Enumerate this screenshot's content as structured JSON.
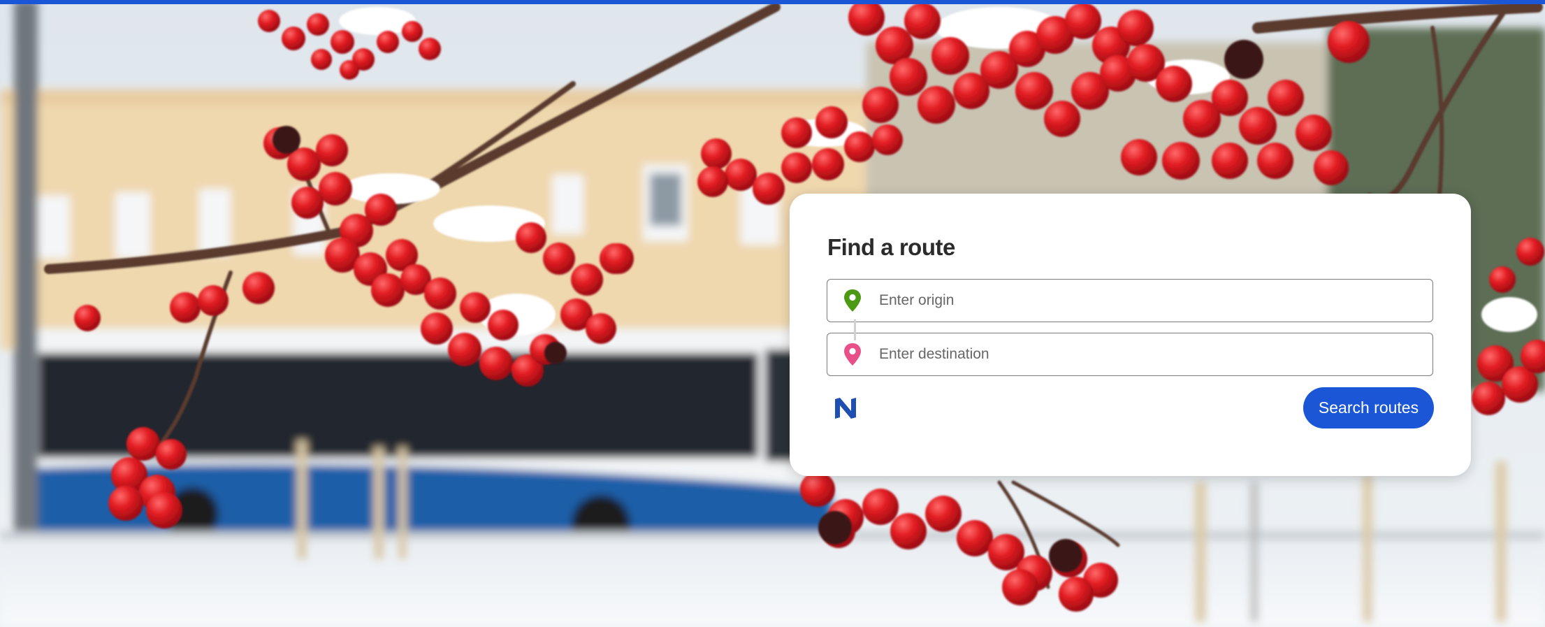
{
  "colors": {
    "accent": "#1a56d6",
    "origin_pin": "#4c9a14",
    "destination_pin": "#e8508a",
    "logo": "#1f4fb0"
  },
  "background": {
    "image": "rowan-berries-snow-bus-icon"
  },
  "route_card": {
    "title": "Find a route",
    "origin": {
      "placeholder": "Enter origin",
      "value": "",
      "icon": "map-pin-icon"
    },
    "destination": {
      "placeholder": "Enter destination",
      "value": "",
      "icon": "map-pin-icon"
    },
    "logo_icon": "brand-logo-icon",
    "search_label": "Search routes"
  }
}
